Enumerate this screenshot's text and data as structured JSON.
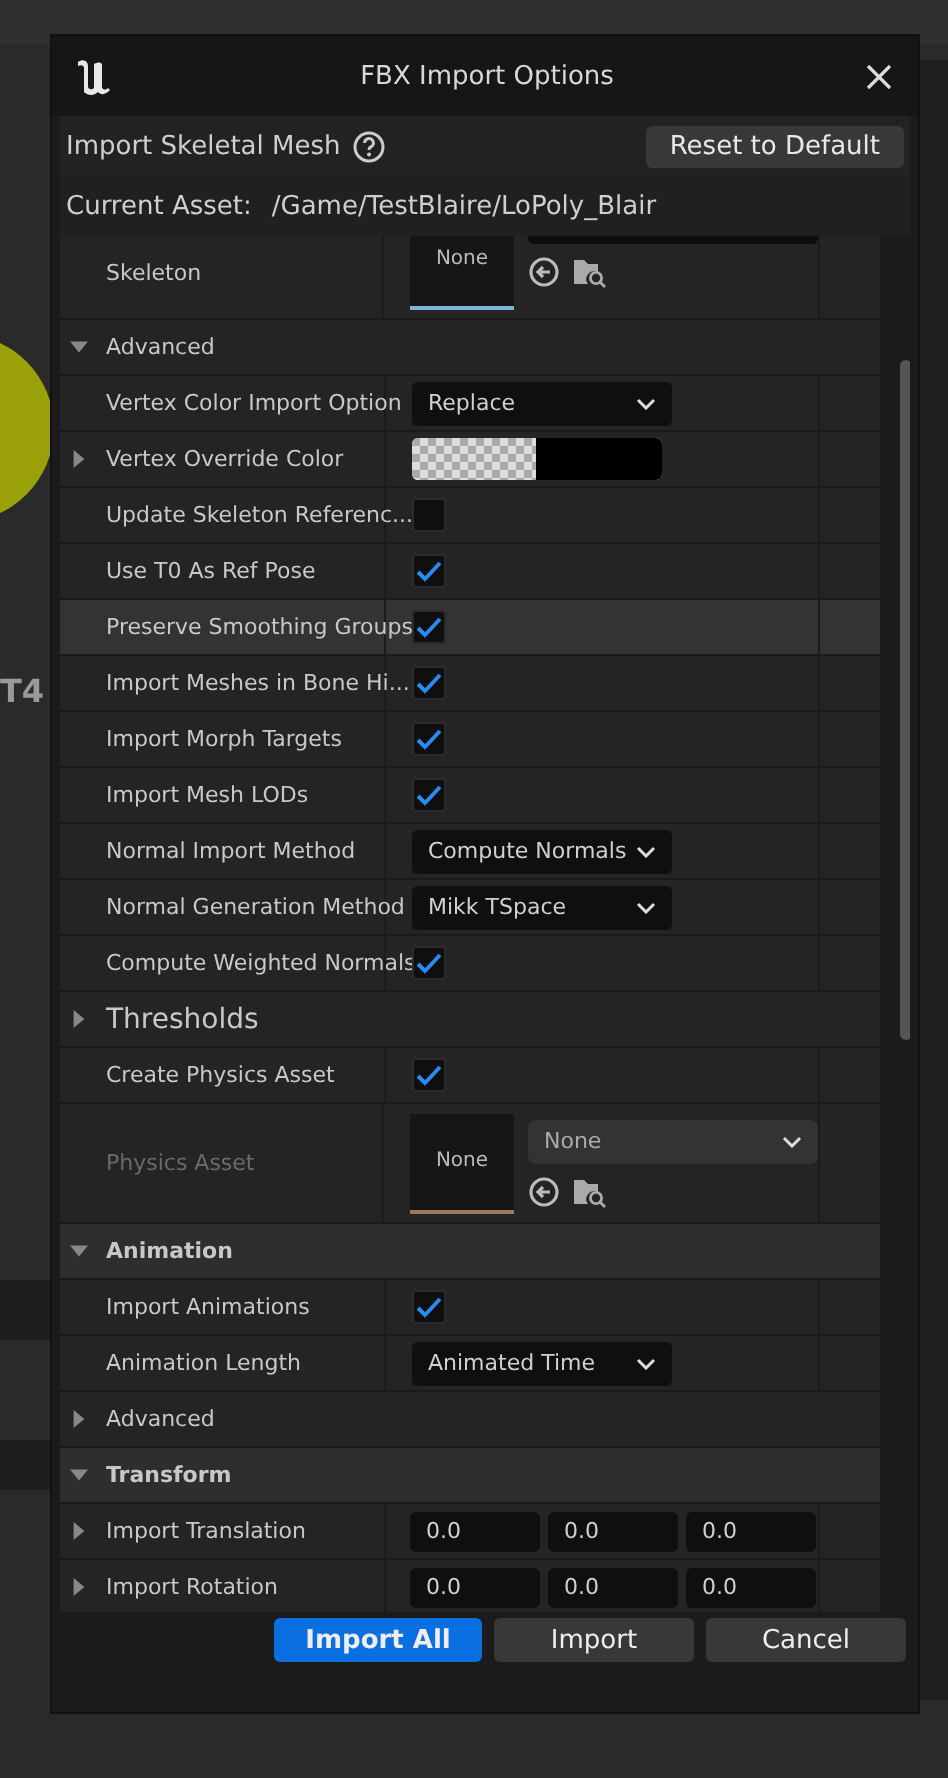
{
  "background_texts": [
    "T4"
  ],
  "window": {
    "title": "FBX Import Options"
  },
  "toolbar": {
    "heading": "Import Skeletal Mesh",
    "reset_button": "Reset to Default"
  },
  "current_asset": {
    "label": "Current Asset:",
    "path": "/Game/TestBlaire/LoPoly_Blair"
  },
  "rows": [
    {
      "kind": "asset",
      "label": "Skeleton",
      "thumb": "None",
      "color": "#7fb6d8"
    },
    {
      "kind": "group",
      "label": "Advanced",
      "expanded": true
    },
    {
      "kind": "dropdown",
      "label": "Vertex Color Import Option",
      "value": "Replace"
    },
    {
      "kind": "color",
      "label": "Vertex Override Color",
      "expanded": false
    },
    {
      "kind": "checkbox",
      "label": "Update Skeleton Referenc...",
      "checked": false
    },
    {
      "kind": "checkbox",
      "label": "Use T0 As Ref Pose",
      "checked": true
    },
    {
      "kind": "checkbox",
      "label": "Preserve Smoothing Groups",
      "checked": true,
      "hovered": true
    },
    {
      "kind": "checkbox",
      "label": "Import Meshes in Bone Hi...",
      "checked": true
    },
    {
      "kind": "checkbox",
      "label": "Import Morph Targets",
      "checked": true
    },
    {
      "kind": "checkbox",
      "label": "Import Mesh LODs",
      "checked": true
    },
    {
      "kind": "dropdown",
      "label": "Normal Import Method",
      "value": "Compute Normals"
    },
    {
      "kind": "dropdown",
      "label": "Normal Generation Method",
      "value": "Mikk TSpace"
    },
    {
      "kind": "checkbox",
      "label": "Compute Weighted Normals",
      "checked": true
    },
    {
      "kind": "heading",
      "label": "Thresholds",
      "expanded": false
    },
    {
      "kind": "checkbox",
      "label": "Create Physics Asset",
      "checked": true
    },
    {
      "kind": "asset",
      "label": "Physics Asset",
      "thumb": "None",
      "picker": "None",
      "color": "#9a7a5e",
      "disabled": true
    },
    {
      "kind": "section",
      "label": "Animation",
      "expanded": true
    },
    {
      "kind": "checkbox",
      "label": "Import Animations",
      "checked": true
    },
    {
      "kind": "dropdown",
      "label": "Animation Length",
      "value": "Animated Time"
    },
    {
      "kind": "group",
      "label": "Advanced",
      "expanded": false
    },
    {
      "kind": "section",
      "label": "Transform",
      "expanded": true
    },
    {
      "kind": "vector",
      "label": "Import Translation",
      "values": [
        "0.0",
        "0.0",
        "0.0"
      ],
      "expanded": false
    },
    {
      "kind": "vector",
      "label": "Import Rotation",
      "values": [
        "0.0",
        "0.0",
        "0.0"
      ],
      "expanded": false
    }
  ],
  "buttons": [
    {
      "label": "Import All",
      "primary": true
    },
    {
      "label": "Import",
      "primary": false
    },
    {
      "label": "Cancel",
      "primary": false
    }
  ]
}
